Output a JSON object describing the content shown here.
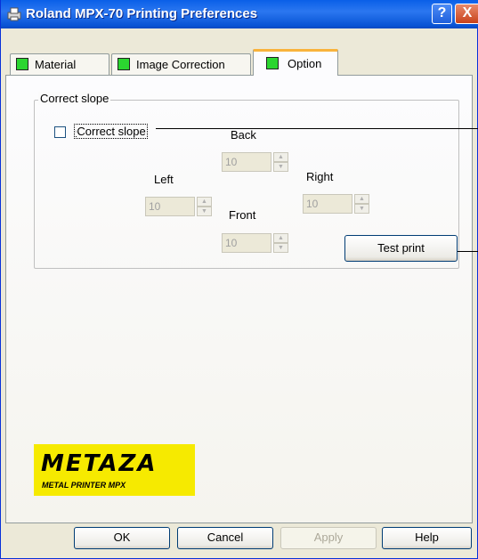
{
  "window": {
    "title": "Roland MPX-70 Printing Preferences",
    "help_label": "?",
    "close_label": "X"
  },
  "tabs": [
    {
      "label": "Material"
    },
    {
      "label": "Image Correction"
    },
    {
      "label": "Option",
      "selected": true
    }
  ],
  "group": {
    "title": "Correct slope",
    "checkbox": {
      "label": "Correct slope",
      "checked": false
    },
    "back": {
      "label": "Back",
      "value": "10"
    },
    "left": {
      "label": "Left",
      "value": "10"
    },
    "right": {
      "label": "Right",
      "value": "10"
    },
    "front": {
      "label": "Front",
      "value": "10"
    },
    "test_print_label": "Test print"
  },
  "logo": {
    "main": "METAZA",
    "sub": "METAL PRINTER MPX"
  },
  "buttons": {
    "ok": "OK",
    "cancel": "Cancel",
    "apply": "Apply",
    "help": "Help"
  },
  "colors": {
    "titlebar": "#0a5fe8",
    "tab_indicator": "#2bd630",
    "logo_bg": "#f6ea00",
    "selected_tab_accent": "#f9b33c"
  }
}
